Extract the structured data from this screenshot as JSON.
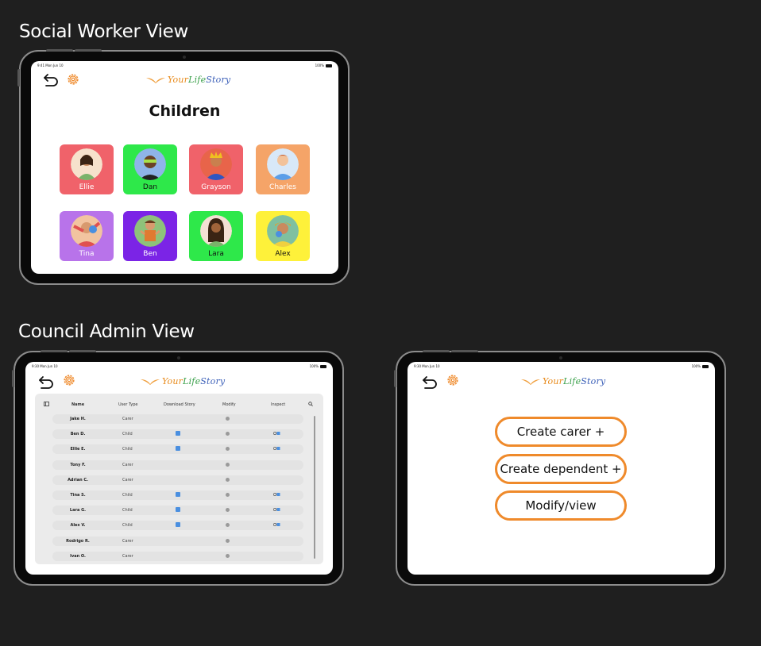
{
  "sections": {
    "social_worker": "Social Worker View",
    "council_admin": "Council Admin View"
  },
  "status_bar": {
    "time_sw": "9:41  Mon Jun 10",
    "time_admin": "9:30  Mon Jun 10",
    "battery": "100%"
  },
  "logo": {
    "your": "Your",
    "life": "Life",
    "story": "Story"
  },
  "social_worker_screen": {
    "title": "Children",
    "children": [
      {
        "name": "Ellie",
        "color": "#f0626a"
      },
      {
        "name": "Dan",
        "color": "#2ee84a"
      },
      {
        "name": "Grayson",
        "color": "#f0626a"
      },
      {
        "name": "Charles",
        "color": "#f5a468"
      },
      {
        "name": "Tina",
        "color": "#b873ea"
      },
      {
        "name": "Ben",
        "color": "#7b24e6"
      },
      {
        "name": "Lara",
        "color": "#2ee84a"
      },
      {
        "name": "Alex",
        "color": "#fef13a"
      }
    ]
  },
  "admin_table": {
    "headers": {
      "name": "Name",
      "user_type": "User Type",
      "download_story": "Download Story",
      "modify": "Modify",
      "inspect": "Inspect"
    },
    "rows": [
      {
        "name": "Jake H.",
        "type": "Carer"
      },
      {
        "name": "Ben D.",
        "type": "Child"
      },
      {
        "name": "Ellie E.",
        "type": "Child"
      },
      {
        "name": "Tony F.",
        "type": "Carer"
      },
      {
        "name": "Adrian C.",
        "type": "Carer"
      },
      {
        "name": "Tina S.",
        "type": "Child"
      },
      {
        "name": "Lara G.",
        "type": "Child"
      },
      {
        "name": "Alex V.",
        "type": "Child"
      },
      {
        "name": "Rodrigo R.",
        "type": "Carer"
      },
      {
        "name": "Ivan O.",
        "type": "Carer"
      }
    ]
  },
  "admin_actions": {
    "create_carer": "Create carer +",
    "create_dependent": "Create dependent +",
    "modify_view": "Modify/view"
  },
  "colors": {
    "accent": "#ef8a2b",
    "background": "#1f1f1f"
  },
  "icons": [
    "back-arrow-icon",
    "gear-icon",
    "download-icon",
    "modify-icon",
    "inspect-icon",
    "sidebar-toggle-icon",
    "search-icon"
  ]
}
